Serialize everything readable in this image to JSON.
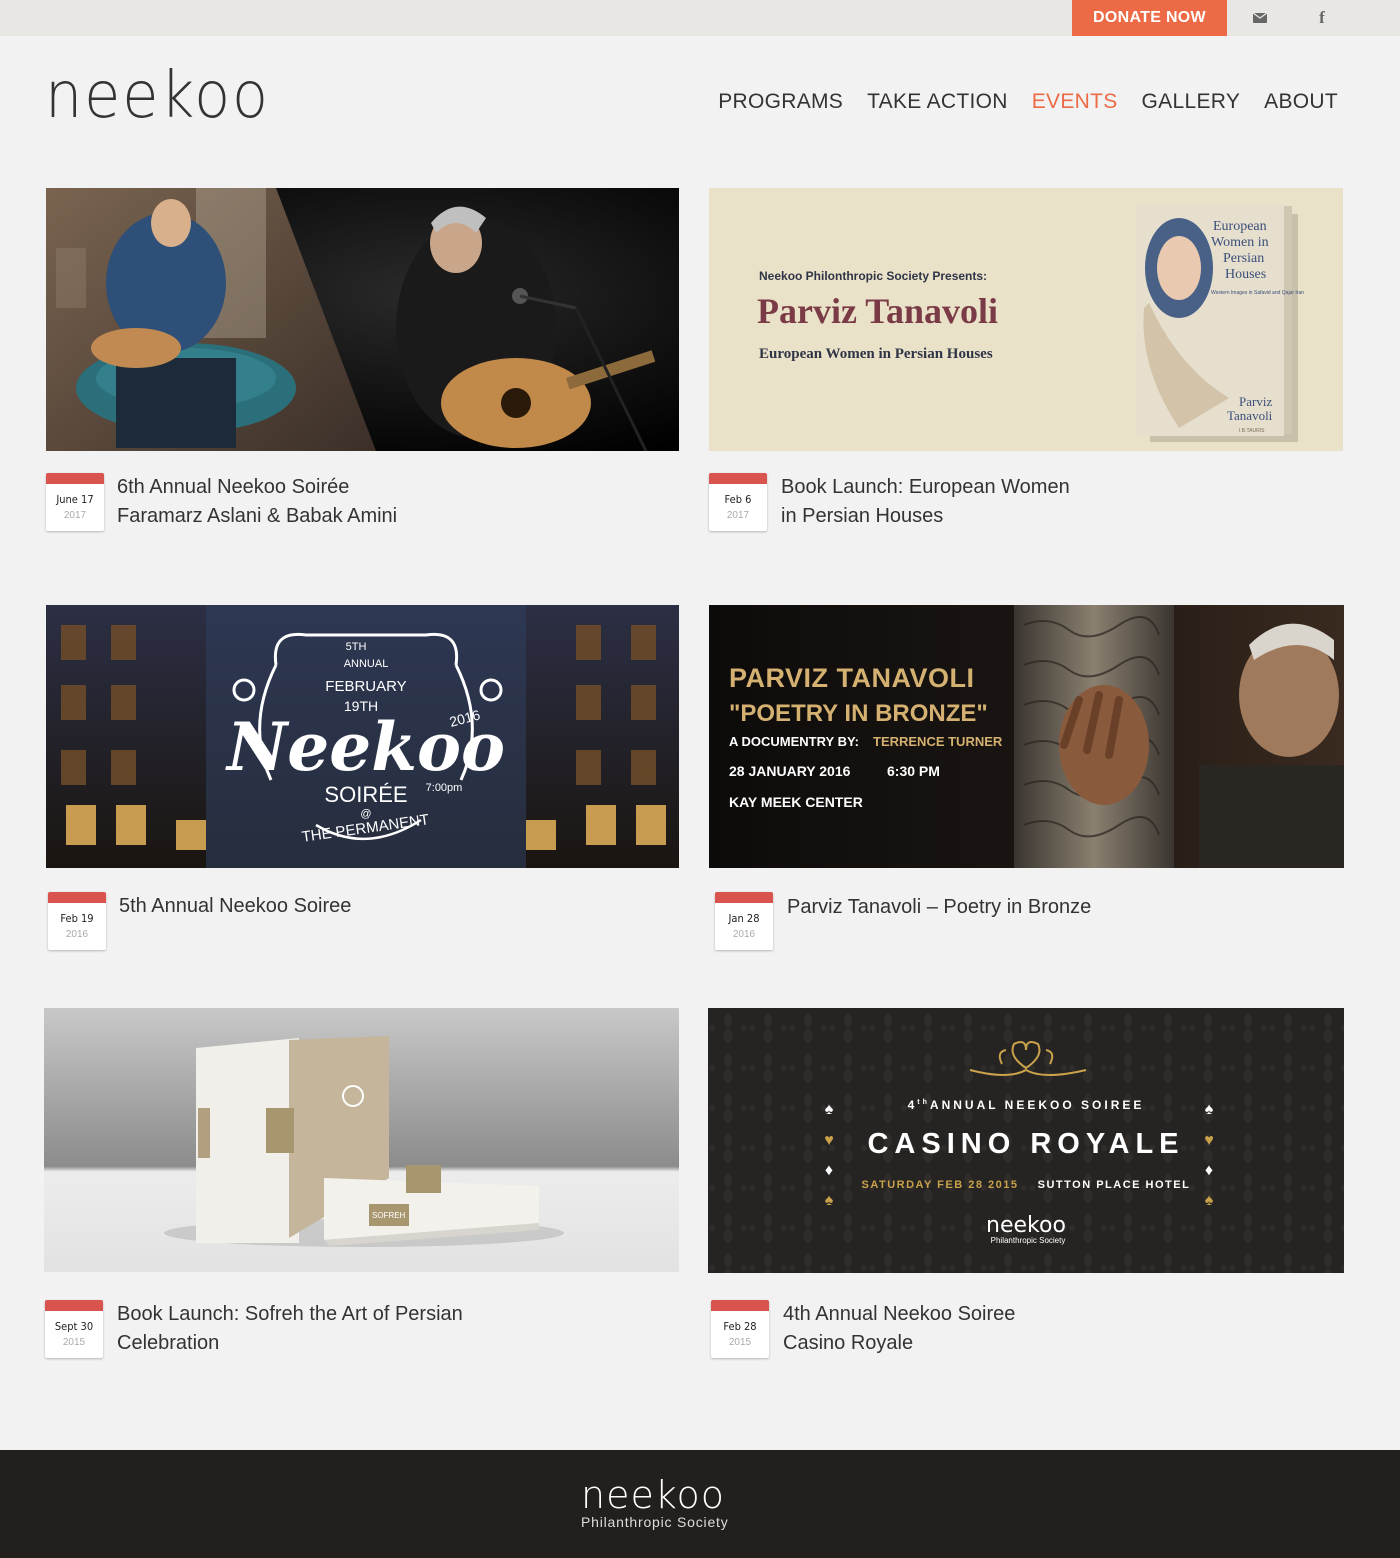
{
  "topbar": {
    "donate_label": "DONATE NOW",
    "mail_icon": "mail-icon",
    "facebook_icon": "facebook-icon",
    "facebook_glyph": "f"
  },
  "header": {
    "logo_text": "neekoo",
    "nav": [
      {
        "label": "PROGRAMS",
        "active": false
      },
      {
        "label": "TAKE ACTION",
        "active": false
      },
      {
        "label": "EVENTS",
        "active": true
      },
      {
        "label": "GALLERY",
        "active": false
      },
      {
        "label": "ABOUT",
        "active": false
      }
    ]
  },
  "events": [
    {
      "day": "June 17",
      "year": "2017",
      "title_lines": [
        "6th Annual Neekoo Soirée",
        "Faramarz Aslani & Babak Amini"
      ]
    },
    {
      "day": "Feb 6",
      "year": "2017",
      "title_lines": [
        "Book Launch: European Women",
        "in Persian Houses"
      ],
      "banner": {
        "presents": "Neekoo Philonthropic Society Presents:",
        "name": "Parviz Tanavoli",
        "subtitle": "European Women in Persian Houses",
        "book_title": "European Women in Persian Houses",
        "book_subtitle": "Western Images in Safavid and Qajar Iran",
        "book_author": "Parviz Tanavoli",
        "book_publisher": "I.B.TAURIS"
      }
    },
    {
      "day": "Feb 19",
      "year": "2016",
      "title_lines": [
        "5th Annual Neekoo Soiree"
      ],
      "banner": {
        "ordinal": "5TH",
        "annual": "ANNUAL",
        "month": "FEBRUARY",
        "date": "19TH",
        "year": "2016",
        "name": "Neekoo",
        "soiree": "SOIRÉE",
        "time": "7:00pm",
        "at": "@",
        "venue": "THE PERMANENT"
      }
    },
    {
      "day": "Jan 28",
      "year": "2016",
      "title_lines": [
        "Parviz Tanavoli – Poetry in Bronze"
      ],
      "banner": {
        "line1": "PARVIZ TANAVOLI",
        "line2": "\"POETRY IN BRONZE\"",
        "doc_by": "A DOCUMENTRY BY:",
        "doc_name": "TERRENCE TURNER",
        "date": "28 JANUARY 2016",
        "time": "6:30 PM",
        "venue": "KAY MEEK CENTER"
      }
    },
    {
      "day": "Sept 30",
      "year": "2015",
      "title_lines": [
        "Book Launch: Sofreh the Art of Persian",
        "Celebration"
      ],
      "banner": {
        "book_label": "SOFREH"
      }
    },
    {
      "day": "Feb 28",
      "year": "2015",
      "title_lines": [
        "4th Annual Neekoo Soiree",
        "Casino Royale"
      ],
      "banner": {
        "annual_num": "4",
        "annual_sup": "th",
        "annual_text": "ANNUAL NEEKOO SOIREE",
        "name": "CASINO ROYALE",
        "date": "SATURDAY FEB 28 2015",
        "venue": "SUTTON PLACE HOTEL",
        "logo": "neekoo",
        "logo_sub": "Philanthropic Society"
      }
    }
  ],
  "footer": {
    "logo_text": "neekoo",
    "sub": "Philanthropic Society"
  },
  "colors": {
    "accent": "#ec6a45",
    "calendar_red": "#d9534f",
    "footer_bg": "#231f1c",
    "gold": "#c9a24a",
    "maroon": "#7a3b46"
  }
}
